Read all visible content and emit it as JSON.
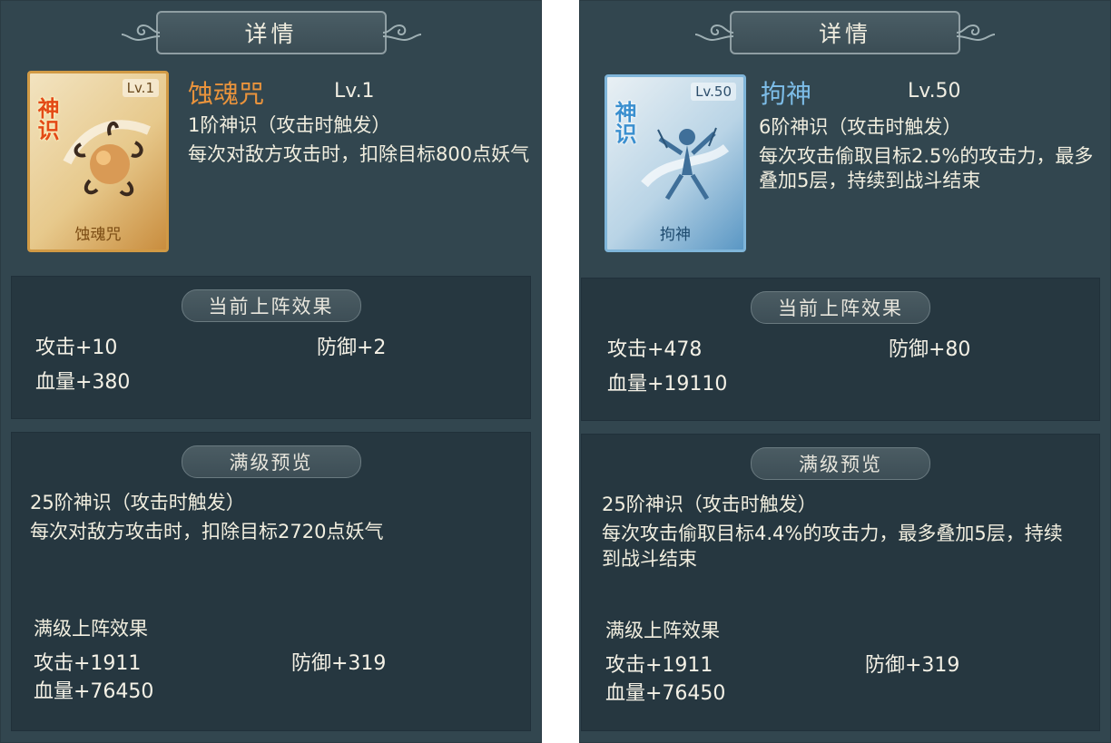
{
  "left": {
    "title": "详情",
    "card": {
      "lv": "Lv.1",
      "badge": "神识",
      "name": "蚀魂咒"
    },
    "name": "蚀魂咒",
    "name_color": "#e9933c",
    "level": "Lv.1",
    "tier": "1阶神识（攻击时触发）",
    "description": "每次对敌方攻击时，扣除目标800点妖气",
    "current": {
      "header": "当前上阵效果",
      "attack": "攻击+10",
      "defense": "防御+2",
      "hp": "血量+380"
    },
    "preview": {
      "header": "满级预览",
      "tier": "25阶神识（攻击时触发）",
      "description": "每次对敌方攻击时，扣除目标2720点妖气",
      "max_label": "满级上阵效果",
      "attack": "攻击+1911",
      "defense": "防御+319",
      "hp": "血量+76450"
    }
  },
  "right": {
    "title": "详情",
    "card": {
      "lv": "Lv.50",
      "badge": "神识",
      "name": "拘神"
    },
    "name": "拘神",
    "name_color": "#7dbde8",
    "level": "Lv.50",
    "tier": "6阶神识（攻击时触发）",
    "description": "每次攻击偷取目标2.5%的攻击力，最多叠加5层，持续到战斗结束",
    "current": {
      "header": "当前上阵效果",
      "attack": "攻击+478",
      "defense": "防御+80",
      "hp": "血量+19110"
    },
    "preview": {
      "header": "满级预览",
      "tier": "25阶神识（攻击时触发）",
      "description": "每次攻击偷取目标4.4%的攻击力，最多叠加5层，持续到战斗结束",
      "max_label": "满级上阵效果",
      "attack": "攻击+1911",
      "defense": "防御+319",
      "hp": "血量+76450"
    }
  }
}
